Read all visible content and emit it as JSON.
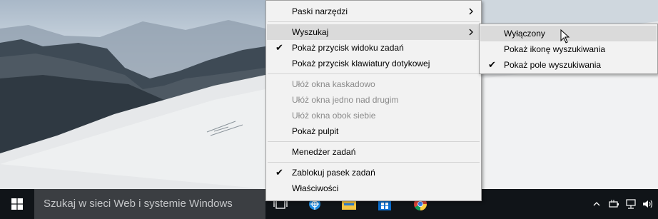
{
  "taskbar": {
    "search_placeholder": "Szukaj w sieci Web i systemie Windows",
    "background_color": "#101418",
    "pinned_icons": [
      "task-view-icon",
      "internet-explorer-icon",
      "file-explorer-icon",
      "store-icon",
      "chrome-icon"
    ],
    "tray_icons": [
      "chevron-up-icon",
      "power-icon",
      "network-icon",
      "volume-icon"
    ]
  },
  "context_menu": {
    "items": [
      {
        "label": "Paski narzędzi",
        "has_submenu": true
      },
      {
        "label": "Wyszukaj",
        "has_submenu": true,
        "highlighted": true
      },
      {
        "label": "Pokaż przycisk widoku zadań",
        "checked": true
      },
      {
        "label": "Pokaż przycisk klawiatury dotykowej"
      },
      {
        "label": "Ułóż okna kaskadowo",
        "disabled": true
      },
      {
        "label": "Ułóż okna jedno nad drugim",
        "disabled": true
      },
      {
        "label": "Ułóż okna obok siebie",
        "disabled": true
      },
      {
        "label": "Pokaż pulpit"
      },
      {
        "label": "Menedżer zadań"
      },
      {
        "label": "Zablokuj pasek zadań",
        "checked": true
      },
      {
        "label": "Właściwości"
      }
    ]
  },
  "search_submenu": {
    "items": [
      {
        "label": "Wyłączony",
        "highlighted": true
      },
      {
        "label": "Pokaż ikonę wyszukiwania"
      },
      {
        "label": "Pokaż pole wyszukiwania",
        "checked": true
      }
    ]
  },
  "colors": {
    "menu_background": "#f2f2f2",
    "menu_highlight": "#dadada",
    "disabled_text": "#8a8a8a"
  }
}
